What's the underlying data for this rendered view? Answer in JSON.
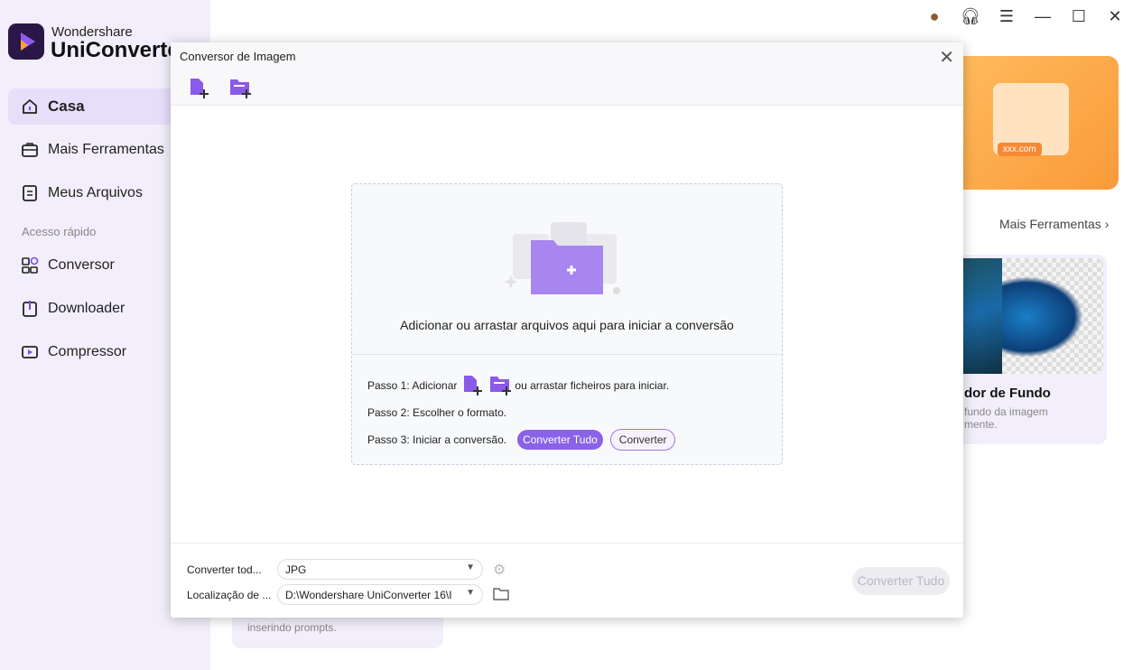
{
  "app": {
    "brand_line1": "Wondershare",
    "brand_line2": "UniConverter"
  },
  "sidebar": {
    "items": [
      {
        "label": "Casa",
        "icon": "home-icon"
      },
      {
        "label": "Mais Ferramentas",
        "icon": "toolbox-icon"
      },
      {
        "label": "Meus Arquivos",
        "icon": "file-icon"
      }
    ],
    "quick_access_label": "Acesso rápido",
    "quick": [
      {
        "label": "Conversor",
        "icon": "converter-icon"
      },
      {
        "label": "Downloader",
        "icon": "download-icon"
      },
      {
        "label": "Compressor",
        "icon": "compress-icon"
      }
    ]
  },
  "background": {
    "more_tools": "Mais Ferramentas",
    "card_title": "dor de Fundo",
    "card_desc1": "fundo da imagem",
    "card_desc2": "mente.",
    "banner_text": "xxx.com",
    "bg_card_text": "inserindo prompts."
  },
  "dialog": {
    "title": "Conversor de Imagem",
    "drop_message": "Adicionar ou arrastar arquivos aqui para iniciar a conversão",
    "step1_a": "Passo 1: Adicionar",
    "step1_b": "ou arrastar ficheiros para iniciar.",
    "step2": "Passo 2: Escolher o formato.",
    "step3": "Passo 3: Iniciar a conversão.",
    "convert_all": "Converter Tudo",
    "convert": "Converter",
    "format_label": "Converter tod...",
    "format_value": "JPG",
    "location_label": "Localização de ...",
    "location_value": "D:\\Wondershare UniConverter 16\\I",
    "footer_convert_all": "Converter Tudo"
  },
  "colors": {
    "accent": "#8a62e8",
    "sidebar_bg": "#f2eefb"
  }
}
